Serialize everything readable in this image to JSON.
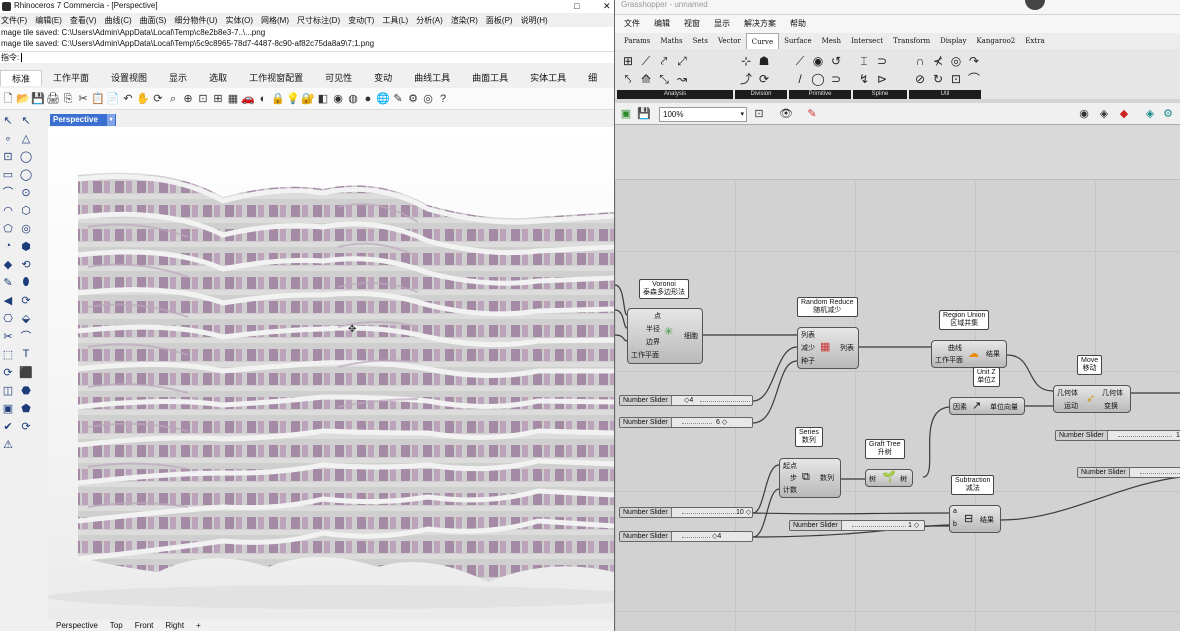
{
  "rhino": {
    "title": "Rhinoceros 7 Commercia - [Perspective]",
    "window_controls": [
      "□",
      "✕"
    ],
    "menu": [
      "文件(F)",
      "编辑(E)",
      "查看(V)",
      "曲线(C)",
      "曲面(S)",
      "细分物件(U)",
      "实体(O)",
      "网格(M)",
      "尺寸标注(D)",
      "变动(T)",
      "工具(L)",
      "分析(A)",
      "渲染(R)",
      "面板(P)",
      "说明(H)"
    ],
    "cmd_history": [
      "mage tile saved: C:\\Users\\Admin\\AppData\\Local\\Temp\\c8e2b8e3-7..\\...png",
      "mage tile saved: C:\\Users\\Admin\\AppData\\Local\\Temp\\5c9c8965-78d7-4487-8c90-af82c75da8a9\\7;1.png"
    ],
    "cmd_prompt": "指令:",
    "tabs": [
      "标准",
      "工作平面",
      "设置视图",
      "显示",
      "选取",
      "工作视窗配置",
      "可见性",
      "变动",
      "曲线工具",
      "曲面工具",
      "实体工具",
      "细"
    ],
    "active_tab": "标准",
    "toolbar_icons": [
      "new-icon",
      "open-icon",
      "save-icon",
      "print-icon",
      "copy-icon",
      "cut-icon",
      "clipboard-icon",
      "paste-icon",
      "undo-icon",
      "pan-icon",
      "rotate-icon",
      "zoom-icon",
      "zoom-window-icon",
      "zoom-extents-icon",
      "zoom-selected-icon",
      "grid-icon",
      "car-icon",
      "hide-icon",
      "lock-icon",
      "light-icon",
      "print-lock-icon",
      "layer-icon",
      "material-icon",
      "sphere-icon",
      "render-icon",
      "globe-icon",
      "pen-icon",
      "gear-icon",
      "globe-2-icon",
      "help-icon"
    ],
    "toolbar_glyphs": [
      "🗋",
      "📂",
      "💾",
      "🖨",
      "⎘",
      "✂",
      "📋",
      "📄",
      "↶",
      "✋",
      "⟳",
      "⌕",
      "⊕",
      "⊡",
      "⊞",
      "▦",
      "🚗",
      "◐",
      "🔒",
      "💡",
      "🔐",
      "◧",
      "◉",
      "◍",
      "●",
      "🌐",
      "✎",
      "⚙",
      "◎",
      "?"
    ],
    "left_tools": [
      "↖",
      "↖",
      "∘",
      "△",
      "⊡",
      "◯",
      "▭",
      "◯",
      "⌒",
      "⊙",
      "◠",
      "⬡",
      "⬠",
      "◎",
      "◔",
      "⬢",
      "◆",
      "⟲",
      "✎",
      "⬮",
      "◀",
      "⟳",
      "⎔",
      "⬙",
      "✂",
      "⌒",
      "⬚",
      "T",
      "⟳",
      "⬛",
      "◫",
      "⬣",
      "▣",
      "⬟",
      "✔",
      "⟳",
      "⚠"
    ],
    "viewport_label": "Perspective",
    "viewport_tabs": [
      "Perspective",
      "Top",
      "Front",
      "Right",
      "+"
    ]
  },
  "gh": {
    "title": "Grasshopper - unnamed",
    "menu": [
      "文件",
      "编辑",
      "视窗",
      "显示",
      "解决方案",
      "帮助"
    ],
    "component_tabs": [
      "Params",
      "Maths",
      "Sets",
      "Vector",
      "Curve",
      "Surface",
      "Mesh",
      "Intersect",
      "Transform",
      "Display",
      "Kangaroo2",
      "Extra"
    ],
    "active_component_tab": "Curve",
    "ribbon_panels": [
      {
        "label": "Analysis",
        "icons": [
          "⊞",
          "⟋",
          "⤤",
          "⤢",
          "⤣",
          "⟰",
          "⤡",
          "↝"
        ]
      },
      {
        "label": "Division",
        "icons": [
          "⊹",
          "☗",
          "⤴",
          "⟳"
        ]
      },
      {
        "label": "Primitive",
        "icons": [
          "⟋",
          "◉",
          "↺",
          "/",
          "◯",
          "⊃"
        ]
      },
      {
        "label": "Spline",
        "icons": [
          "⌶",
          "⊃",
          "↯",
          "⊳"
        ]
      },
      {
        "label": "Util",
        "icons": [
          "∩",
          "⊀",
          "◎",
          "↷",
          "⊘",
          "↻",
          "⊡",
          "⌒"
        ]
      }
    ],
    "zoom": "100%",
    "components": {
      "voronoi": {
        "name": "Voronoi",
        "sub": "泰森多边形法",
        "inputs": [
          "点",
          "半径",
          "边界",
          "工作平面"
        ],
        "output": "细胞"
      },
      "random_reduce": {
        "name": "Random Reduce",
        "sub": "随机减少",
        "inputs": [
          "列表",
          "减少",
          "种子"
        ],
        "output": "列表"
      },
      "region_union": {
        "name": "Region Union",
        "sub": "区域并集",
        "inputs": [
          "曲线",
          "工作平面"
        ],
        "output": "结果"
      },
      "unit_z": {
        "name": "Unit Z",
        "sub": "单位Z",
        "inputs": [
          "因素"
        ],
        "output": "单位向量"
      },
      "move": {
        "name": "Move",
        "sub": "移动",
        "inputs": [
          "几何体",
          "运动"
        ],
        "outputs": [
          "几何体",
          "变换"
        ]
      },
      "series": {
        "name": "Series",
        "sub": "数列",
        "inputs": [
          "起点",
          "步",
          "计数"
        ],
        "output": "数列"
      },
      "graft_tree": {
        "name": "Graft Tree",
        "sub": "升树",
        "input": "树",
        "output": "树"
      },
      "subtraction": {
        "name": "Subtraction",
        "sub": "减法",
        "inputs": [
          "a",
          "b"
        ],
        "output": "结果"
      }
    },
    "sliders": [
      {
        "name": "Number Slider",
        "value": "◇4"
      },
      {
        "name": "Number Slider",
        "value": "6 ◇"
      },
      {
        "name": "Number Slider",
        "value": "10 ◇"
      },
      {
        "name": "Number Slider",
        "value": "◇4"
      },
      {
        "name": "Number Slider",
        "value": "1 ◇"
      },
      {
        "name": "Number Slider",
        "value": "1"
      },
      {
        "name": "Number Slider",
        "value": ""
      }
    ]
  }
}
